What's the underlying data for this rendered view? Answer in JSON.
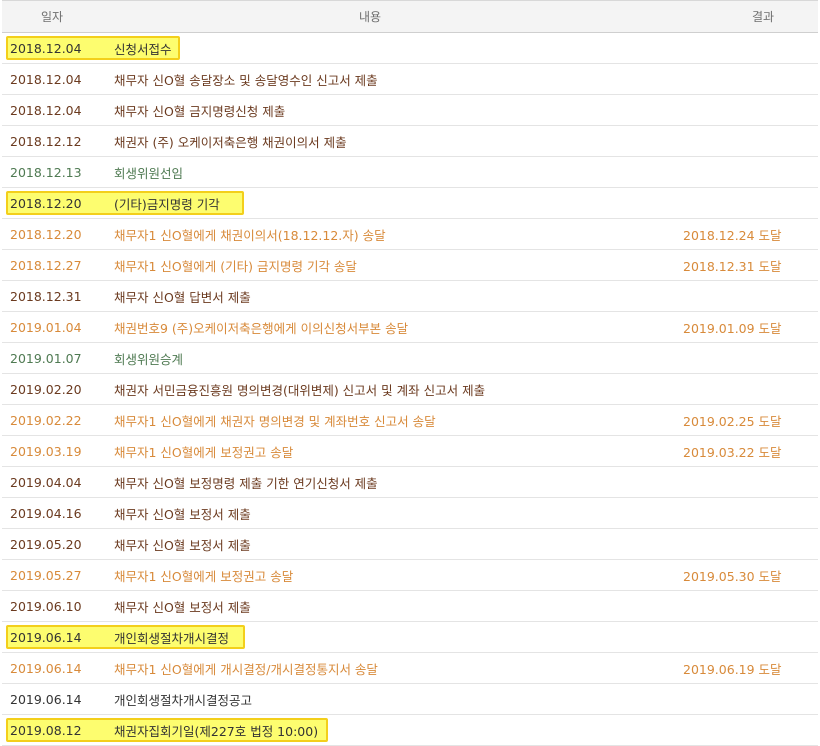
{
  "header": {
    "date": "일자",
    "content": "내용",
    "result": "결과"
  },
  "rows": [
    {
      "date": "2018.12.04",
      "content": "신청서접수",
      "result": "",
      "style": "black",
      "highlight": true
    },
    {
      "date": "2018.12.04",
      "content": "채무자 신O혈 송달장소 및 송달영수인 신고서 제출",
      "result": "",
      "style": "dark",
      "highlight": false
    },
    {
      "date": "2018.12.04",
      "content": "채무자 신O혈 금지명령신청 제출",
      "result": "",
      "style": "dark",
      "highlight": false
    },
    {
      "date": "2018.12.12",
      "content": "채권자 (주) 오케이저축은행 채권이의서 제출",
      "result": "",
      "style": "dark",
      "highlight": false
    },
    {
      "date": "2018.12.13",
      "content": "회생위원선임",
      "result": "",
      "style": "green",
      "highlight": false
    },
    {
      "date": "2018.12.20",
      "content": "(기타)금지명령 기각",
      "result": "",
      "style": "black",
      "highlight": true
    },
    {
      "date": "2018.12.20",
      "content": "채무자1 신O혈에게 채권이의서(18.12.12.자) 송달",
      "result": "2018.12.24 도달",
      "style": "orange",
      "highlight": false
    },
    {
      "date": "2018.12.27",
      "content": "채무자1 신O혈에게 (기타) 금지명령 기각 송달",
      "result": "2018.12.31 도달",
      "style": "orange",
      "highlight": false
    },
    {
      "date": "2018.12.31",
      "content": "채무자 신O혈 답변서 제출",
      "result": "",
      "style": "dark",
      "highlight": false
    },
    {
      "date": "2019.01.04",
      "content": "채권번호9 (주)오케이저축은행에게 이의신청서부본 송달",
      "result": "2019.01.09 도달",
      "style": "orange",
      "highlight": false
    },
    {
      "date": "2019.01.07",
      "content": "회생위원승계",
      "result": "",
      "style": "green",
      "highlight": false
    },
    {
      "date": "2019.02.20",
      "content": "채권자 서민금융진흥원 명의변경(대위변제) 신고서 및 계좌 신고서 제출",
      "result": "",
      "style": "dark",
      "highlight": false
    },
    {
      "date": "2019.02.22",
      "content": "채무자1 신O혈에게 채권자 명의변경 및 계좌번호 신고서 송달",
      "result": "2019.02.25 도달",
      "style": "orange",
      "highlight": false
    },
    {
      "date": "2019.03.19",
      "content": "채무자1 신O혈에게 보정권고 송달",
      "result": "2019.03.22 도달",
      "style": "orange",
      "highlight": false
    },
    {
      "date": "2019.04.04",
      "content": "채무자 신O혈 보정명령 제출 기한 연기신청서 제출",
      "result": "",
      "style": "dark",
      "highlight": false
    },
    {
      "date": "2019.04.16",
      "content": "채무자 신O혈 보정서 제출",
      "result": "",
      "style": "dark",
      "highlight": false
    },
    {
      "date": "2019.05.20",
      "content": "채무자 신O혈 보정서 제출",
      "result": "",
      "style": "dark",
      "highlight": false
    },
    {
      "date": "2019.05.27",
      "content": "채무자1 신O혈에게 보정권고 송달",
      "result": "2019.05.30 도달",
      "style": "orange",
      "highlight": false
    },
    {
      "date": "2019.06.10",
      "content": "채무자 신O혈 보정서 제출",
      "result": "",
      "style": "dark",
      "highlight": false
    },
    {
      "date": "2019.06.14",
      "content": "개인회생절차개시결정",
      "result": "",
      "style": "black",
      "highlight": true
    },
    {
      "date": "2019.06.14",
      "content": "채무자1 신O혈에게 개시결정/개시결정통지서 송달",
      "result": "2019.06.19 도달",
      "style": "orange",
      "highlight": false
    },
    {
      "date": "2019.06.14",
      "content": "개인회생절차개시결정공고",
      "result": "",
      "style": "black",
      "highlight": false
    },
    {
      "date": "2019.08.12",
      "content": "채권자집회기일(제227호 법정 10:00)",
      "result": "",
      "style": "black",
      "highlight": true
    }
  ]
}
